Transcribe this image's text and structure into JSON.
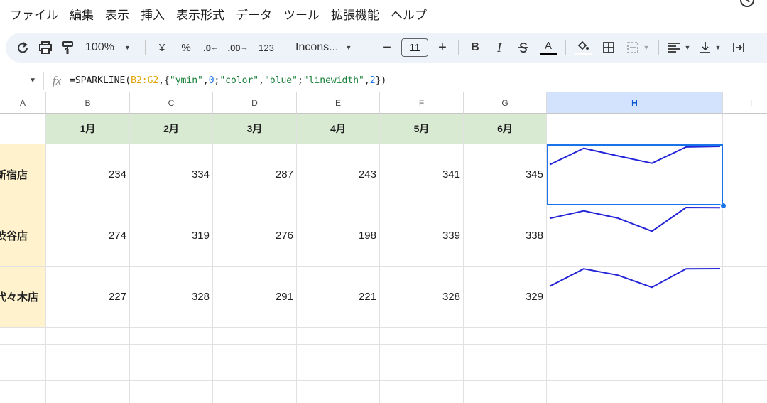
{
  "menu": [
    "ファイル",
    "編集",
    "表示",
    "挿入",
    "表示形式",
    "データ",
    "ツール",
    "拡張機能",
    "ヘルプ"
  ],
  "toolbar": {
    "zoom": "100%",
    "currency": "¥",
    "percent": "%",
    "dec_decrease": ".0",
    "dec_increase": ".00",
    "number_format": "123",
    "font": "Incons...",
    "font_size": "11",
    "minus": "−",
    "plus": "+",
    "bold": "B",
    "italic": "I",
    "text_color_letter": "A"
  },
  "formula_bar": {
    "fx": "fx",
    "parts": [
      {
        "text": "=SPARKLINE(",
        "kind": "plain"
      },
      {
        "text": "B2:G2",
        "kind": "range"
      },
      {
        "text": ",{",
        "kind": "plain"
      },
      {
        "text": "\"ymin\"",
        "kind": "str"
      },
      {
        "text": ",",
        "kind": "plain"
      },
      {
        "text": "0",
        "kind": "num"
      },
      {
        "text": ";",
        "kind": "plain"
      },
      {
        "text": "\"color\"",
        "kind": "str"
      },
      {
        "text": ",",
        "kind": "plain"
      },
      {
        "text": "\"blue\"",
        "kind": "str"
      },
      {
        "text": ";",
        "kind": "plain"
      },
      {
        "text": "\"linewidth\"",
        "kind": "str"
      },
      {
        "text": ",",
        "kind": "plain"
      },
      {
        "text": "2",
        "kind": "num"
      },
      {
        "text": "})",
        "kind": "plain"
      }
    ]
  },
  "columns": [
    "A",
    "B",
    "C",
    "D",
    "E",
    "F",
    "G",
    "H",
    "I"
  ],
  "selected_column": "H",
  "months": [
    "1月",
    "2月",
    "3月",
    "4月",
    "5月",
    "6月"
  ],
  "rows": [
    {
      "store": "新宿店",
      "values": [
        234,
        334,
        287,
        243,
        341,
        345
      ]
    },
    {
      "store": "渋谷店",
      "values": [
        274,
        319,
        276,
        198,
        339,
        338
      ]
    },
    {
      "store": "代々木店",
      "values": [
        227,
        328,
        291,
        221,
        328,
        329
      ]
    }
  ],
  "sparkline": {
    "ymin": 0,
    "color": "blue",
    "linewidth": 2
  },
  "colors": {
    "month_header_bg": "#d9ead3",
    "store_bg": "#fff2cc",
    "selection": "#1a73e8",
    "sparkline": "#2323d8"
  }
}
